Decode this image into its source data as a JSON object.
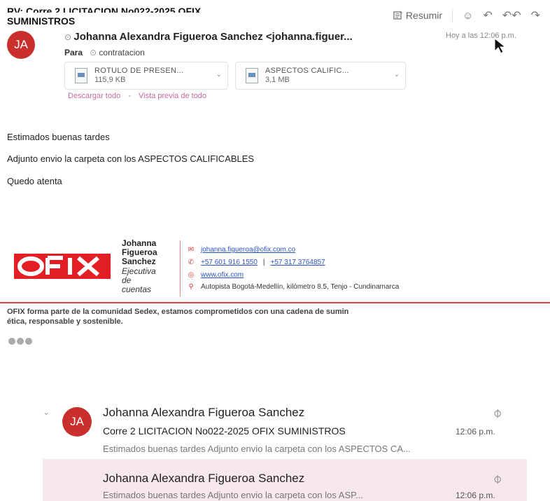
{
  "email": {
    "subject_partial": "RV: Corre 2 LICITACION No022-2025 OFIX",
    "subject_second_line": "SUMINISTROS",
    "toolbar": {
      "summarize_label": "Resumir"
    },
    "sender_avatar_initials": "JA",
    "sender_display": "Johanna Alexandra Figueroa Sanchez <johanna.figuer...",
    "timestamp": "Hoy a las 12:06 p.m.",
    "to_label": "Para",
    "to_recipient": "contratacion",
    "attachments": [
      {
        "name": "ROTULO DE PRESEN...",
        "size": "115,9 KB"
      },
      {
        "name": "ASPECTOS CALIFIC...",
        "size": "3,1 MB"
      }
    ],
    "download_all_label": "Descargar todo",
    "link_separator": "-",
    "preview_all_label": "Vista previa de todo",
    "body": [
      "Estimados buenas tardes",
      "Adjunto envio la carpeta con los ASPECTOS CALIFICABLES",
      "Quedo atenta"
    ],
    "signature": {
      "logo_text": "OFIX",
      "name_lines": [
        "Johanna",
        "Figueroa",
        "Sanchez"
      ],
      "role_lines": [
        "Ejecutiva",
        "de",
        "cuentas"
      ],
      "email": "johanna.figueroa@ofix.com.co",
      "phone1": "+57 601 916 1550",
      "phone_separator": "|",
      "phone2": "+57 317 3764857",
      "website": "www.ofix.com",
      "address": "Autopista Bogotá-Medellín, kilómetro 8.5, Tenjo - Cundinamarca"
    },
    "sedex_line1": "OFIX forma parte de la comunidad Sedex, estamos comprometidos con una cadena de sumin",
    "sedex_line2": "ética, responsable y sostenible."
  },
  "message_list": [
    {
      "avatar_initials": "JA",
      "sender": "Johanna Alexandra Figueroa Sanchez",
      "subject": "Corre 2 LICITACION No022-2025 OFIX SUMINISTROS",
      "time": "12:06 p.m.",
      "preview": "Estimados buenas tardes Adjunto envio la carpeta con los ASPECTOS CA..."
    },
    {
      "sender": "Johanna Alexandra Figueroa Sanchez",
      "preview": "Estimados buenas tardes Adjunto envio la carpeta con los ASP...",
      "time": "12:06 p.m."
    }
  ],
  "colors": {
    "avatar": "#c9302c",
    "link_pink": "#c56b9b",
    "brand_red": "#d23a3a",
    "link_blue": "#2a55c9",
    "selected_row": "#f7e8ec"
  }
}
